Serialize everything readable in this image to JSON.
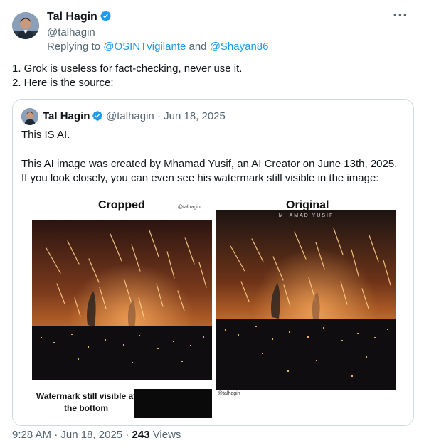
{
  "tweet": {
    "author_name": "Tal Hagin",
    "author_handle": "@talhagin",
    "replying_prefix": "Replying to",
    "replying_user1": "@OSINTvigilante",
    "replying_and": "and",
    "replying_user2": "@Shayan86",
    "text_line1": "1. Grok is useless for fact-checking, never use it.",
    "text_line2": "2. Here is the source:",
    "more_icon": "more-icon",
    "verified_icon": "verified-badge-icon"
  },
  "quote": {
    "author_name": "Tal Hagin",
    "author_handle": "@talhagin",
    "separator": "·",
    "date": "Jun 18, 2025",
    "line1": "This IS AI.",
    "line2": "This AI image was created by Mhamad Yusif, an AI Creator on June 13th, 2025.",
    "line3": " If you look closely, you can even see his watermark still visible in the image:",
    "media": {
      "label_cropped": "Cropped",
      "label_original": "Original",
      "small_watermark_top": "@talhagin",
      "watermark_overlay": "MHAMAD YUSIF",
      "small_watermark_bottom": "@talhagin",
      "caption": "Watermark still visible at the bottom"
    }
  },
  "footer": {
    "time": "9:28 AM",
    "sep1": "·",
    "date": "Jun 18, 2025",
    "sep2": "·",
    "views_count": "243",
    "views_label": "Views"
  },
  "colors": {
    "link": "#1d9bf0",
    "secondary_text": "#536471",
    "border": "#cfd9de"
  }
}
